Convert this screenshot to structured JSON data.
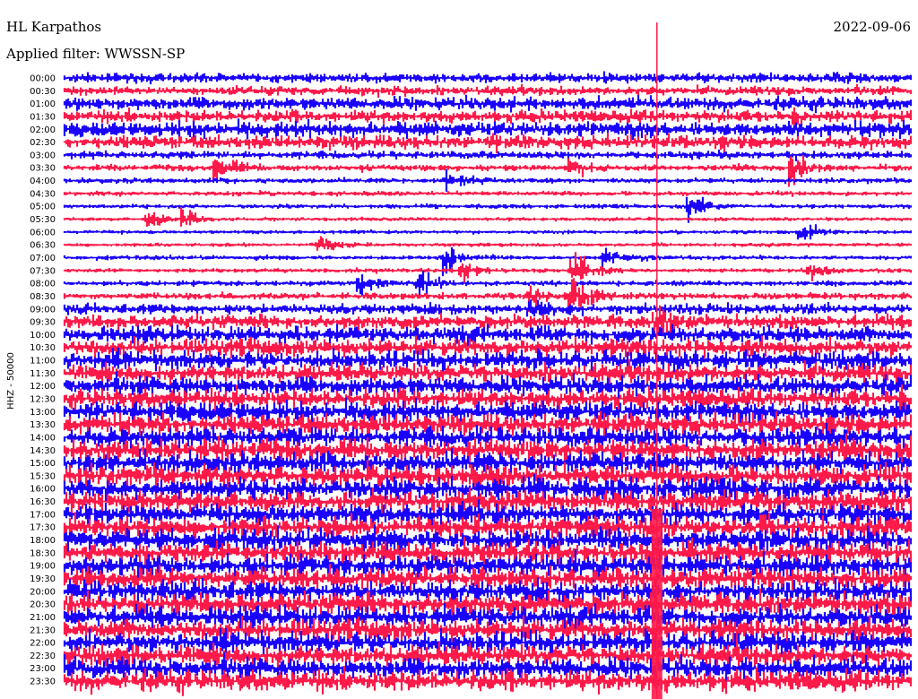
{
  "header": {
    "station": "HL Karpathos",
    "date": "2022-09-06",
    "filter_text": "Applied filter: WWSSN-SP"
  },
  "colors": {
    "trace_a": "#1a00ff",
    "trace_b": "#ff1a4a",
    "background": "#ffffff",
    "text": "#000000"
  },
  "chart_data": {
    "type": "helicorder",
    "channel_label": "HHZ - 50000",
    "row_labels": [
      "00:00",
      "00:30",
      "01:00",
      "01:30",
      "02:00",
      "02:30",
      "03:00",
      "03:30",
      "04:00",
      "04:30",
      "05:00",
      "05:30",
      "06:00",
      "06:30",
      "07:00",
      "07:30",
      "08:00",
      "08:30",
      "09:00",
      "09:30",
      "10:00",
      "10:30",
      "11:00",
      "11:30",
      "12:00",
      "12:30",
      "13:00",
      "13:30",
      "14:00",
      "14:30",
      "15:00",
      "15:30",
      "16:00",
      "16:30",
      "17:00",
      "17:30",
      "18:00",
      "18:30",
      "19:00",
      "19:30",
      "20:00",
      "20:30",
      "21:00",
      "21:30",
      "22:00",
      "22:30",
      "23:00",
      "23:30"
    ],
    "row_colors": [
      "trace_a",
      "trace_b"
    ],
    "noise_level": [
      0.9,
      0.85,
      1.3,
      1.2,
      1.5,
      1.3,
      0.7,
      0.55,
      0.45,
      0.4,
      0.35,
      0.3,
      0.3,
      0.3,
      0.35,
      0.35,
      0.45,
      0.6,
      1.0,
      1.3,
      1.6,
      1.7,
      1.8,
      1.8,
      1.9,
      1.9,
      2.0,
      2.0,
      2.0,
      2.1,
      2.1,
      2.1,
      2.1,
      2.1,
      2.1,
      2.1,
      2.1,
      2.1,
      2.1,
      2.1,
      2.1,
      2.1,
      2.1,
      2.1,
      2.1,
      2.1,
      2.1,
      2.1
    ],
    "events": [
      {
        "row": 7,
        "x": 0.18,
        "amp": 3.5
      },
      {
        "row": 7,
        "x": 0.6,
        "amp": 2.0
      },
      {
        "row": 7,
        "x": 0.86,
        "amp": 3.0
      },
      {
        "row": 8,
        "x": 0.45,
        "amp": 2.5
      },
      {
        "row": 10,
        "x": 0.74,
        "amp": 2.5
      },
      {
        "row": 11,
        "x": 0.1,
        "amp": 2.0
      },
      {
        "row": 11,
        "x": 0.14,
        "amp": 2.5
      },
      {
        "row": 12,
        "x": 0.87,
        "amp": 2.0
      },
      {
        "row": 13,
        "x": 0.3,
        "amp": 2.5
      },
      {
        "row": 14,
        "x": 0.45,
        "amp": 3.5
      },
      {
        "row": 14,
        "x": 0.64,
        "amp": 2.0
      },
      {
        "row": 15,
        "x": 0.47,
        "amp": 2.5
      },
      {
        "row": 15,
        "x": 0.6,
        "amp": 4.0
      },
      {
        "row": 15,
        "x": 0.88,
        "amp": 2.0
      },
      {
        "row": 16,
        "x": 0.35,
        "amp": 2.5
      },
      {
        "row": 16,
        "x": 0.42,
        "amp": 2.5
      },
      {
        "row": 17,
        "x": 0.55,
        "amp": 2.5
      },
      {
        "row": 17,
        "x": 0.6,
        "amp": 5.0
      },
      {
        "row": 18,
        "x": 0.55,
        "amp": 2.0
      },
      {
        "row": 19,
        "x": 0.7,
        "amp": 3.5
      },
      {
        "row": 38,
        "x": 0.6,
        "amp": 2.5
      }
    ],
    "spike_x": 0.7,
    "spike_heavy_from_row": 34
  }
}
